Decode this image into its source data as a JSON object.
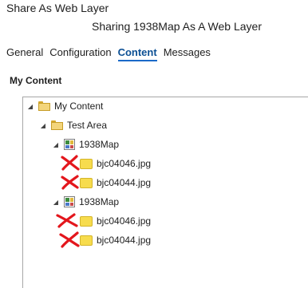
{
  "window": {
    "title": "Share As Web Layer",
    "subtitle": "Sharing 1938Map As A Web Layer"
  },
  "tabs": [
    {
      "label": "General",
      "active": false
    },
    {
      "label": "Configuration",
      "active": false
    },
    {
      "label": "Content",
      "active": true
    },
    {
      "label": "Messages",
      "active": false
    }
  ],
  "section": {
    "title": "My Content"
  },
  "tree": {
    "root": {
      "label": "My Content",
      "icon": "folder-icon",
      "expanded": true
    },
    "folder": {
      "label": "Test Area",
      "icon": "folder-icon",
      "expanded": true
    },
    "maps": [
      {
        "label": "1938Map",
        "icon": "map-icon",
        "expanded": true,
        "layers": [
          {
            "label": "bjc04046.jpg",
            "icon": "raster-layer-icon",
            "marked": true
          },
          {
            "label": "bjc04044.jpg",
            "icon": "raster-layer-icon",
            "marked": true
          }
        ]
      },
      {
        "label": "1938Map",
        "icon": "map-icon",
        "expanded": true,
        "layers": [
          {
            "label": "bjc04046.jpg",
            "icon": "raster-layer-icon",
            "marked": true
          },
          {
            "label": "bjc04044.jpg",
            "icon": "raster-layer-icon",
            "marked": true
          }
        ]
      }
    ]
  },
  "colors": {
    "accent": "#0b4f94",
    "tab_underline": "#1b6ac9",
    "annotation_red": "#e3161c",
    "folder": "#f3d57b",
    "layer": "#f7dc4d"
  }
}
